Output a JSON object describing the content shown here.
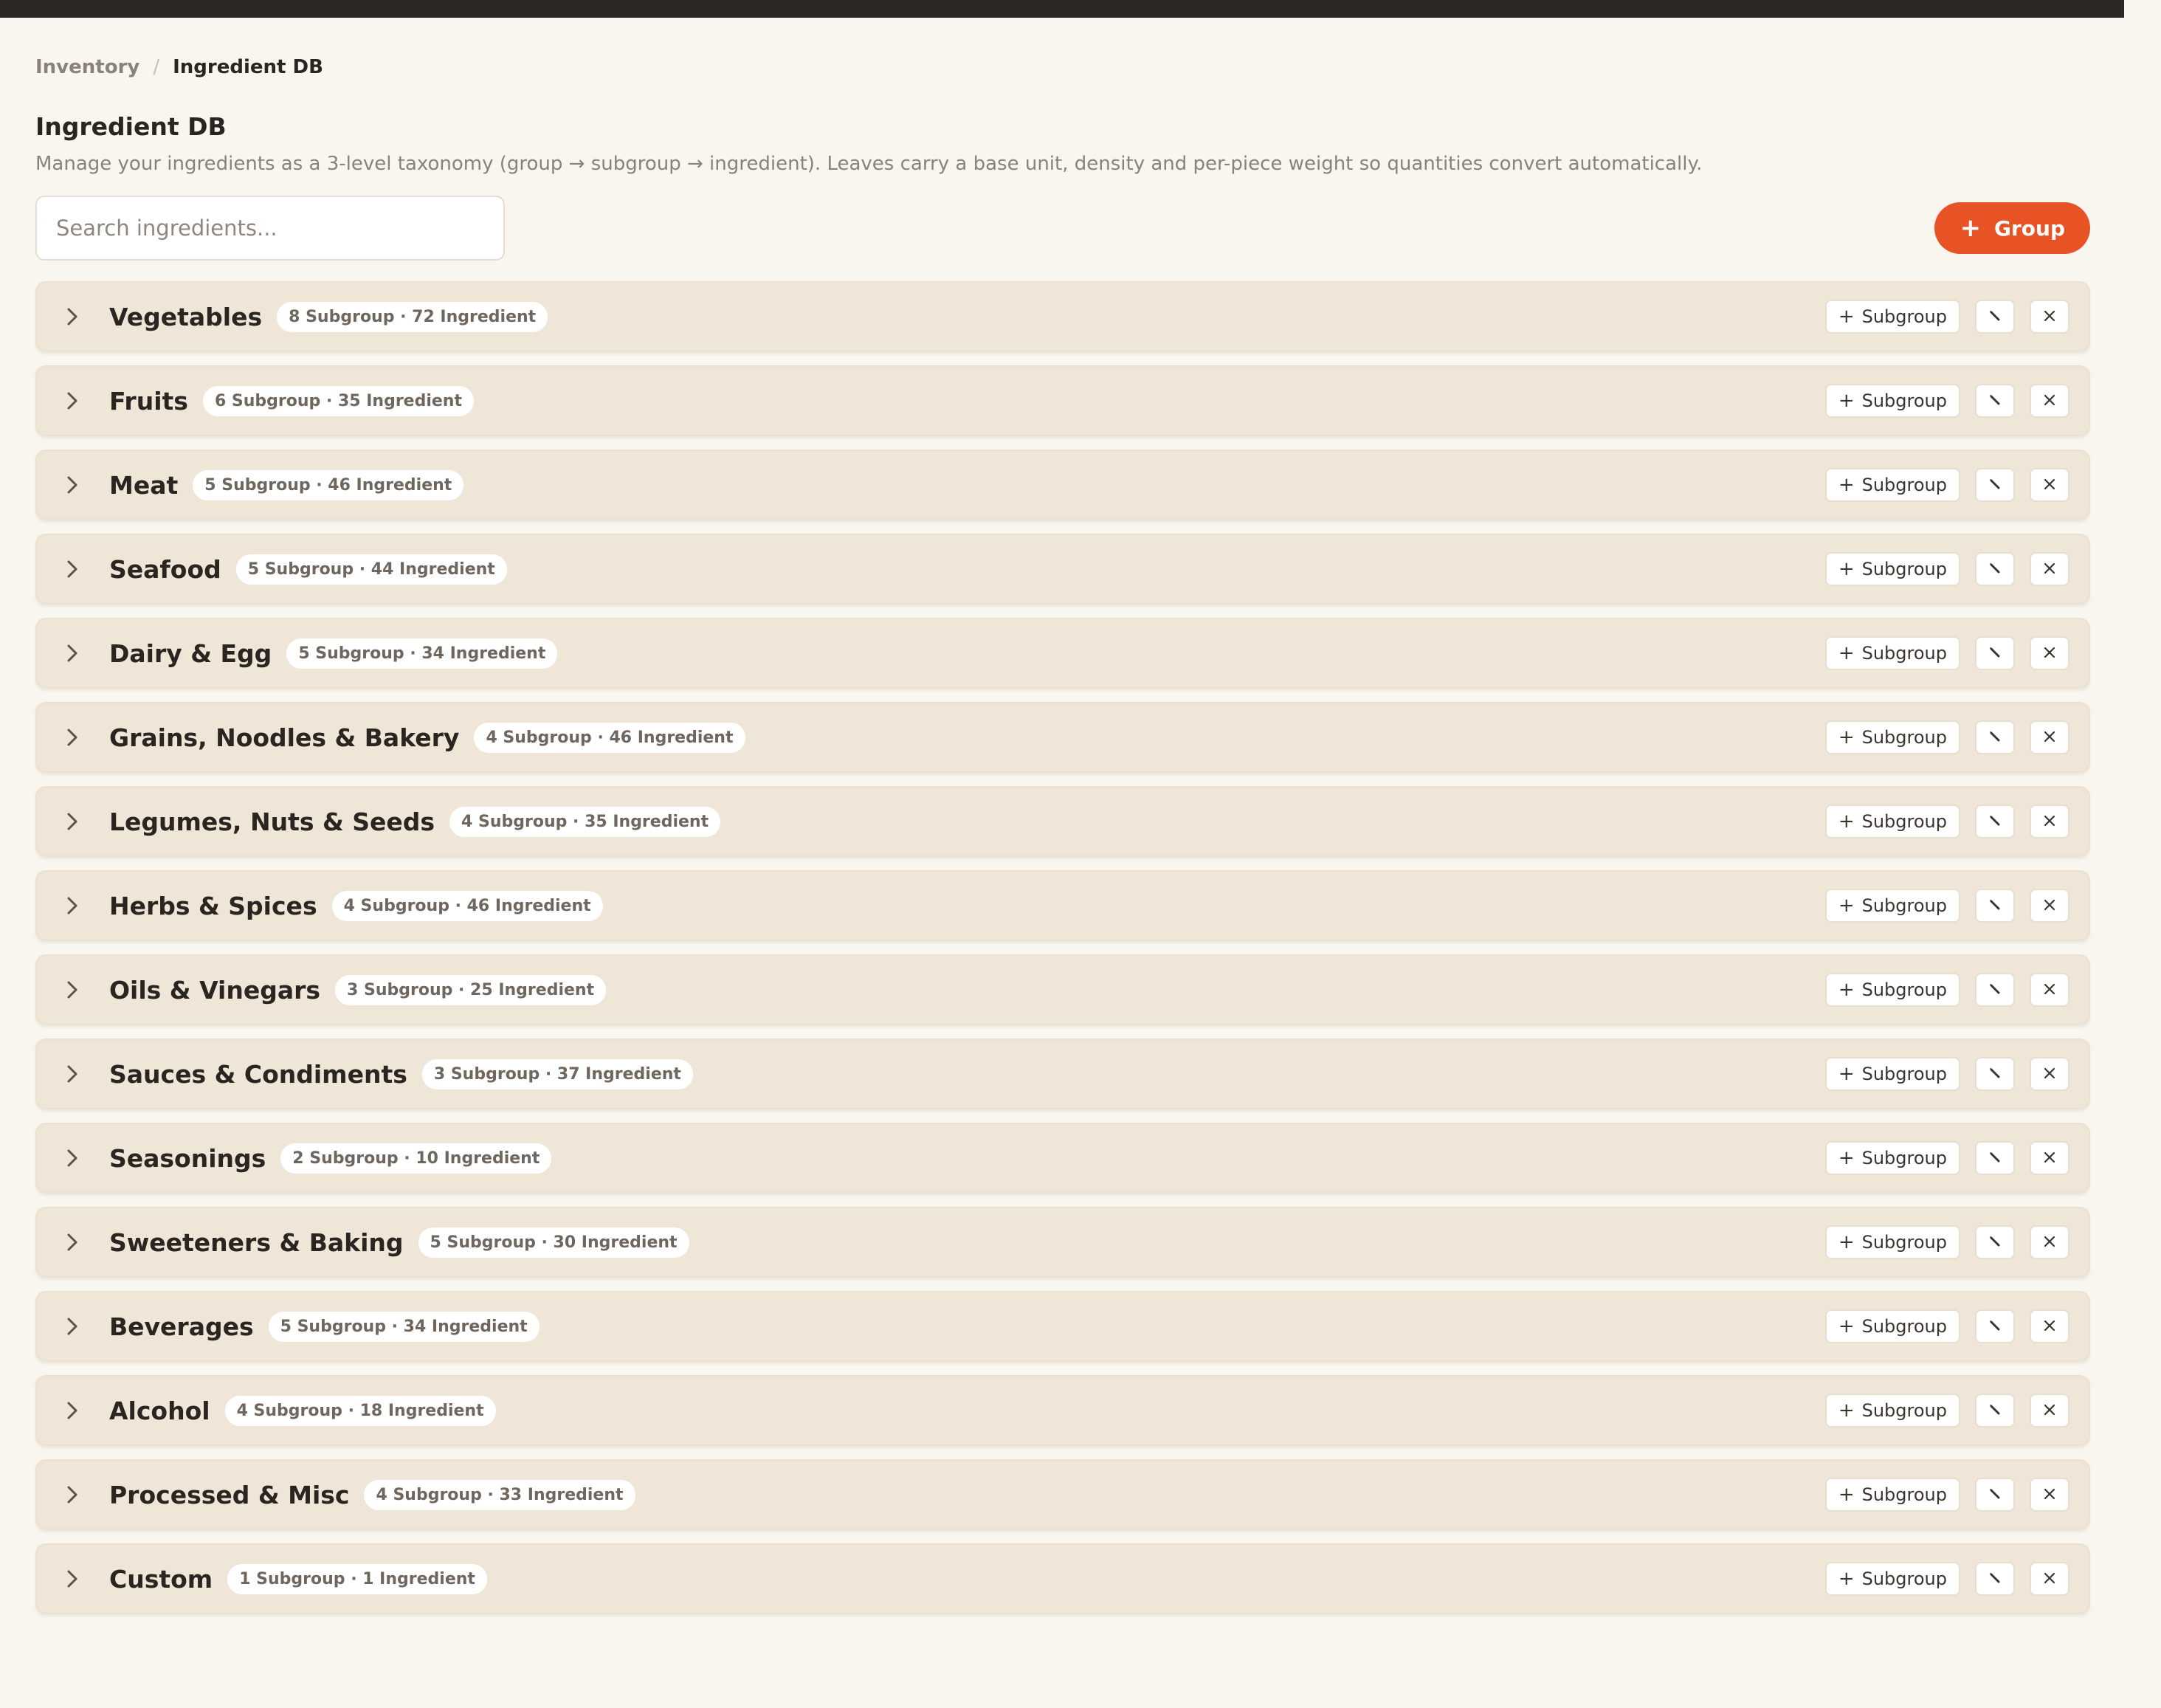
{
  "breadcrumb": {
    "parent": "Inventory",
    "separator": "/",
    "current": "Ingredient DB"
  },
  "page": {
    "title": "Ingredient DB",
    "subtitle": "Manage your ingredients as a 3-level taxonomy (group → subgroup → ingredient). Leaves carry a base unit, density and per-piece weight so quantities convert automatically."
  },
  "search": {
    "placeholder": "Search ingredients..."
  },
  "toolbar": {
    "add_group_label": "Group"
  },
  "row_actions": {
    "add_subgroup_label": "Subgroup"
  },
  "icons": {
    "expand": "chevron-right-icon",
    "add": "plus-icon",
    "edit": "pencil-icon",
    "delete": "close-icon"
  },
  "colors": {
    "accent": "#e85325",
    "row_background": "#f0e6d8",
    "page_background": "#f9f6f0",
    "top_bar": "#2b2724"
  },
  "groups": [
    {
      "name": "Vegetables",
      "counts": "8 Subgroup · 72 Ingredient"
    },
    {
      "name": "Fruits",
      "counts": "6 Subgroup · 35 Ingredient"
    },
    {
      "name": "Meat",
      "counts": "5 Subgroup · 46 Ingredient"
    },
    {
      "name": "Seafood",
      "counts": "5 Subgroup · 44 Ingredient"
    },
    {
      "name": "Dairy & Egg",
      "counts": "5 Subgroup · 34 Ingredient"
    },
    {
      "name": "Grains, Noodles & Bakery",
      "counts": "4 Subgroup · 46 Ingredient"
    },
    {
      "name": "Legumes, Nuts & Seeds",
      "counts": "4 Subgroup · 35 Ingredient"
    },
    {
      "name": "Herbs & Spices",
      "counts": "4 Subgroup · 46 Ingredient"
    },
    {
      "name": "Oils & Vinegars",
      "counts": "3 Subgroup · 25 Ingredient"
    },
    {
      "name": "Sauces & Condiments",
      "counts": "3 Subgroup · 37 Ingredient"
    },
    {
      "name": "Seasonings",
      "counts": "2 Subgroup · 10 Ingredient"
    },
    {
      "name": "Sweeteners & Baking",
      "counts": "5 Subgroup · 30 Ingredient"
    },
    {
      "name": "Beverages",
      "counts": "5 Subgroup · 34 Ingredient"
    },
    {
      "name": "Alcohol",
      "counts": "4 Subgroup · 18 Ingredient"
    },
    {
      "name": "Processed & Misc",
      "counts": "4 Subgroup · 33 Ingredient"
    },
    {
      "name": "Custom",
      "counts": "1 Subgroup · 1 Ingredient"
    }
  ]
}
